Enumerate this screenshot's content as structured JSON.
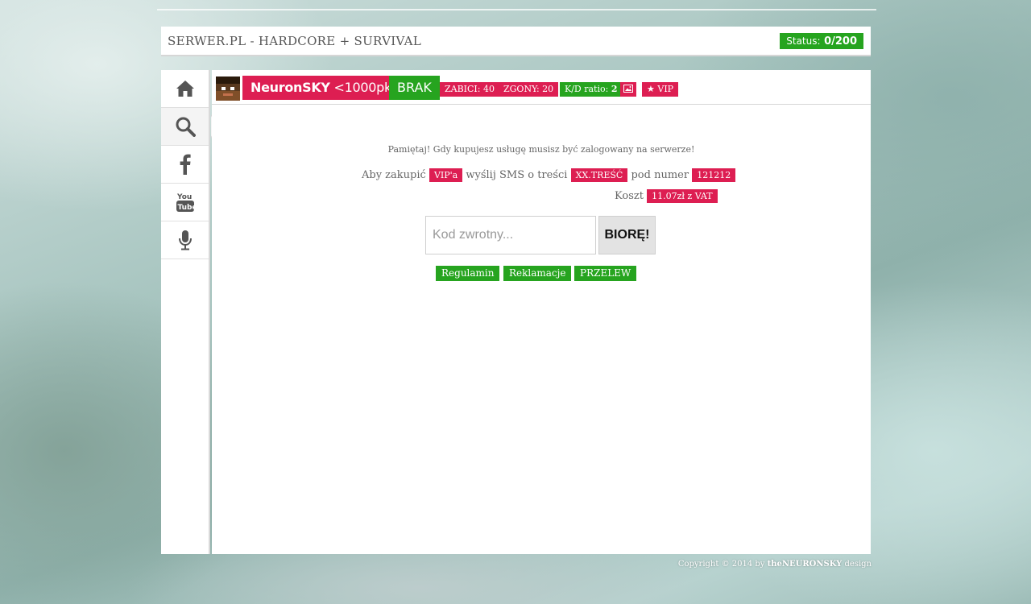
{
  "header": {
    "title": "SERWER.PL - HARDCORE + SURVIVAL",
    "status_label": "Status:",
    "status_value": "0/200"
  },
  "sidebar": {
    "items": [
      {
        "name": "home",
        "icon": "home-icon"
      },
      {
        "name": "search",
        "icon": "search-icon"
      },
      {
        "name": "facebook",
        "icon": "facebook-icon"
      },
      {
        "name": "youtube",
        "icon": "youtube-icon"
      },
      {
        "name": "microphone",
        "icon": "microphone-icon"
      }
    ],
    "active_index": 1
  },
  "player": {
    "nick": "NeuronSKY",
    "points": "<1000pkt>",
    "rank": "BRAK",
    "kills": "ZABICI: 40",
    "deaths": "ZGONY: 20",
    "kd_label": "K/D ratio:",
    "kd_value": "2",
    "vip_label": "VIP"
  },
  "shop": {
    "notice": "Pamiętaj! Gdy kupujesz usługę musisz być zalogowany na serwerze!",
    "sms_prefix": "Aby zakupić",
    "product": "VIP'a",
    "sms_mid": "wyślij SMS o treści",
    "sms_text": "XX.TREŚĆ",
    "sms_number_label": "pod numer",
    "sms_number": "121212",
    "cost_label": "Koszt",
    "cost_value": "11.07zł z VAT",
    "code_placeholder": "Kod zwrotny...",
    "buy_label": "BIORĘ!",
    "links": [
      "Regulamin",
      "Reklamacje",
      "PRZELEW"
    ]
  },
  "footer": {
    "prefix": "Copyright © 2014 by",
    "author": "theNEURONSKY",
    "suffix": "design"
  },
  "colors": {
    "accent_pink": "#dd1e52",
    "accent_green": "#26a41f"
  }
}
